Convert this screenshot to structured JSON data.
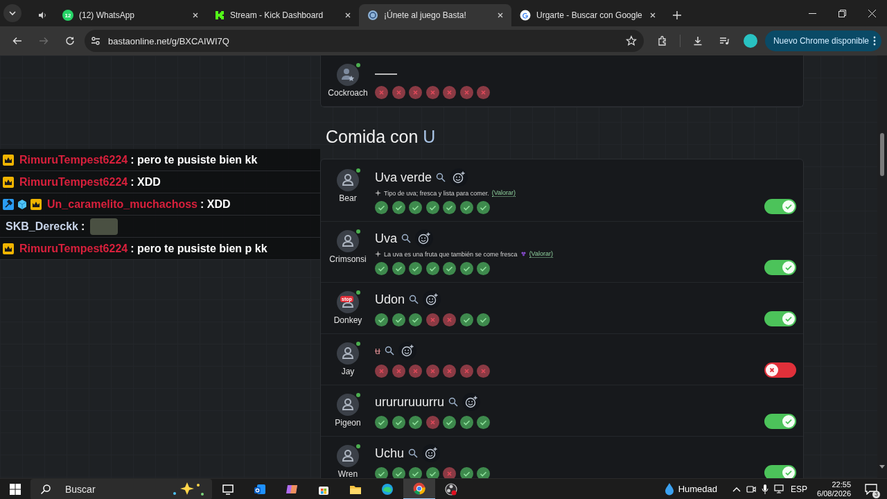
{
  "browser": {
    "tabs": [
      {
        "kind": "audio",
        "selected": false
      },
      {
        "kind": "whatsapp",
        "unread": "12",
        "title": "(12) WhatsApp",
        "selected": false
      },
      {
        "kind": "kick",
        "title": "Stream - Kick Dashboard",
        "selected": false
      },
      {
        "kind": "basta",
        "title": "¡Únete al juego Basta!",
        "selected": true
      },
      {
        "kind": "google",
        "title": "Urgarte - Buscar con Google",
        "selected": false
      }
    ],
    "forward_disabled": true,
    "url": "bastaonline.net/g/BXCAIWI7Q",
    "update_button": "Nuevo Chrome disponible"
  },
  "game": {
    "previous_card": {
      "player": "Cockroach",
      "avatar": {
        "kind": "star"
      },
      "online": true,
      "kind": "blank",
      "votes": [
        false,
        false,
        false,
        false,
        false,
        false,
        false
      ]
    },
    "category": {
      "text": "Comida con",
      "letter": "U"
    },
    "answers": [
      {
        "player": "Bear",
        "avatar": {
          "kind": "person"
        },
        "online": true,
        "kind": "word",
        "answer": "Uva verde",
        "hint": "Tipo de uva; fresca y lista para comer.",
        "rate_link": "(Valorar)",
        "votes": [
          true,
          true,
          true,
          true,
          true,
          true,
          true
        ],
        "valid": true
      },
      {
        "player": "Crimsonsi",
        "avatar": {
          "kind": "person"
        },
        "online": true,
        "kind": "word",
        "answer": "Uva",
        "hint": "La uva es una fruta que también se come fresca",
        "hint_icon": {
          "kind": "grape"
        },
        "rate_link": "(Valorar)",
        "votes": [
          true,
          true,
          true,
          true,
          true,
          true,
          true
        ],
        "valid": true
      },
      {
        "player": "Donkey",
        "avatar": {
          "kind": "person"
        },
        "avatar_badge": "stop",
        "online": true,
        "kind": "word",
        "answer": "Udon",
        "votes": [
          true,
          true,
          true,
          false,
          false,
          true,
          true
        ],
        "valid": true
      },
      {
        "player": "Jay",
        "avatar": {
          "kind": "person"
        },
        "online": true,
        "kind": "word",
        "answer": "u",
        "votes": [
          false,
          false,
          false,
          false,
          false,
          false,
          false
        ],
        "valid": false
      },
      {
        "player": "Pigeon",
        "avatar": {
          "kind": "person"
        },
        "online": true,
        "kind": "word",
        "answer": "urururuuurru",
        "votes": [
          true,
          true,
          true,
          false,
          true,
          true,
          true
        ],
        "valid": true
      },
      {
        "player": "Wren",
        "avatar": {
          "kind": "person"
        },
        "online": true,
        "kind": "word",
        "answer": "Uchu",
        "votes": [
          true,
          true,
          true,
          true,
          false,
          true,
          true
        ],
        "valid": true
      }
    ]
  },
  "chat": [
    {
      "badges": [
        {
          "kind": "crown"
        }
      ],
      "user": "RimuruTempest6224",
      "color": "#d8203c",
      "text": ": pero te pusiste bien kk"
    },
    {
      "badges": [
        {
          "kind": "crown"
        }
      ],
      "user": "RimuruTempest6224",
      "color": "#d8203c",
      "text": ": XDD"
    },
    {
      "badges": [
        {
          "kind": "hammer"
        },
        {
          "kind": "cube"
        },
        {
          "kind": "crown"
        }
      ],
      "user": "Un_caramelito_muchachoss",
      "color": "#d8203c",
      "text": ": XDD"
    },
    {
      "user": "SKB_Dereckk",
      "color": "#c8d4e8",
      "text": ":",
      "emote": true
    },
    {
      "badges": [
        {
          "kind": "crown"
        }
      ],
      "user": "RimuruTempest6224",
      "color": "#d8203c",
      "text": ": pero te pusiste bien p kk"
    }
  ],
  "taskbar": {
    "search_placeholder": "Buscar",
    "apps": [
      {
        "kind": "taskview",
        "selected": false
      },
      {
        "kind": "outlook",
        "selected": false
      },
      {
        "kind": "copilot",
        "selected": false
      },
      {
        "kind": "store",
        "selected": false
      },
      {
        "kind": "folder",
        "selected": false
      },
      {
        "kind": "edge",
        "selected": false
      },
      {
        "kind": "chrome",
        "selected": true
      },
      {
        "kind": "obs",
        "selected": false
      }
    ],
    "weather": "Humedad",
    "language": "ESP",
    "time": "22:55",
    "date": "6/08/2026",
    "notifications": "3"
  }
}
